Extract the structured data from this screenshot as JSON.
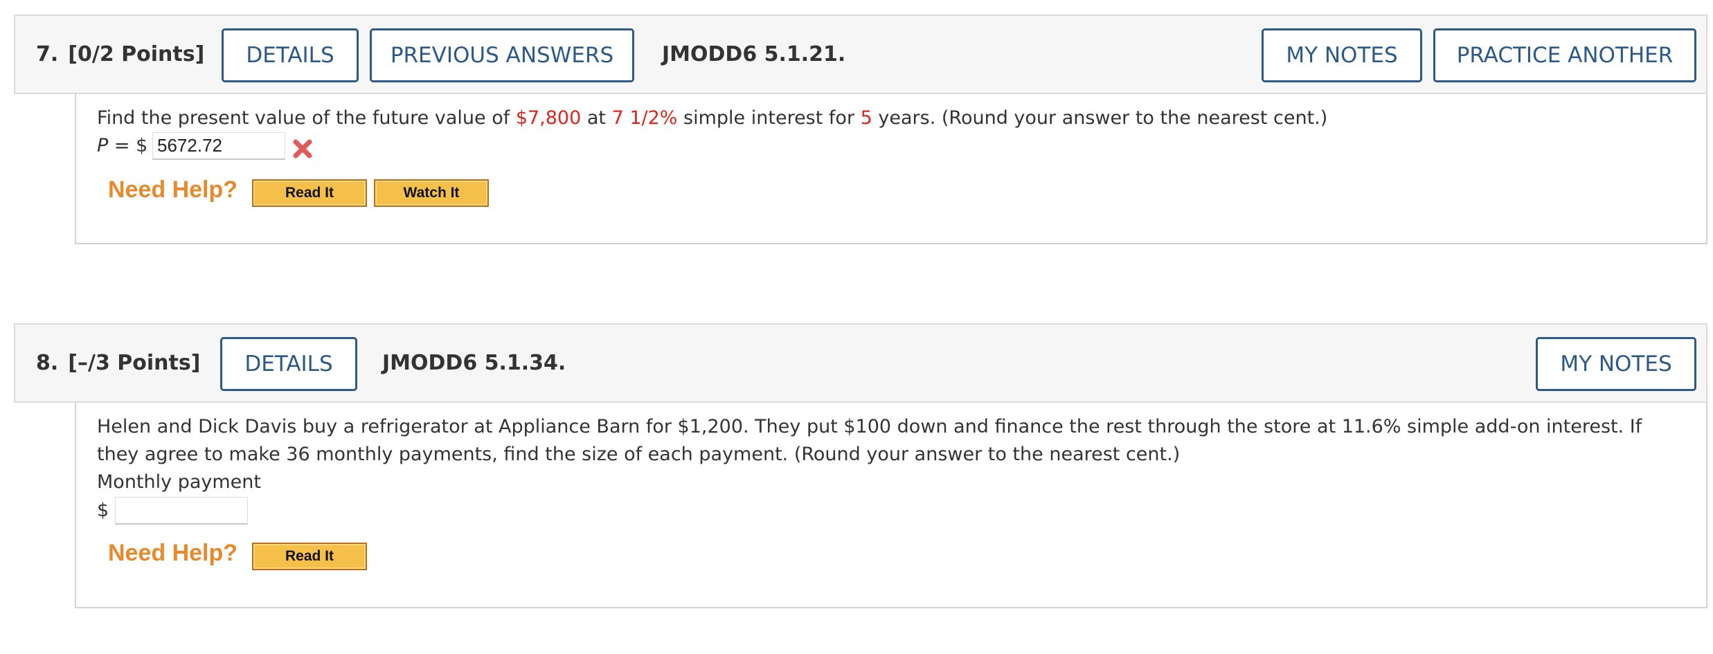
{
  "questions": [
    {
      "number": "7.",
      "points": "[0/2 Points]",
      "details_label": "DETAILS",
      "previous_answers_label": "PREVIOUS ANSWERS",
      "code": "JMODD6 5.1.21.",
      "my_notes_label": "MY NOTES",
      "practice_another_label": "PRACTICE ANOTHER",
      "text_parts": {
        "t1": "Find the present value of the future value of ",
        "v1": "$7,800",
        "t2": " at ",
        "v2": "7 1/2%",
        "t3": " simple interest for ",
        "v3": "5",
        "t4": " years. (Round your answer to the nearest cent.)"
      },
      "answer_prefix_var": "P",
      "answer_prefix_rest": " = $",
      "answer_value": "5672.72",
      "answer_status": "incorrect",
      "need_help_label": "Need Help?",
      "read_it_label": "Read It",
      "watch_it_label": "Watch It"
    },
    {
      "number": "8.",
      "points": "[–/3 Points]",
      "details_label": "DETAILS",
      "code": "JMODD6 5.1.34.",
      "my_notes_label": "MY NOTES",
      "text": "Helen and Dick Davis buy a refrigerator at Appliance Barn for $1,200. They put $100 down and finance the rest through the store at 11.6% simple add-on interest. If they agree to make 36 monthly payments, find the size of each payment. (Round your answer to the nearest cent.)",
      "answer_label": "Monthly payment",
      "answer_prefix": "$",
      "answer_value": "",
      "need_help_label": "Need Help?",
      "read_it_label": "Read It"
    }
  ],
  "colors": {
    "button_border": "#2b5a8a",
    "highlight_red": "#e0251b",
    "need_help_orange": "#e8892c",
    "help_button_fill": "#f5c04a"
  }
}
